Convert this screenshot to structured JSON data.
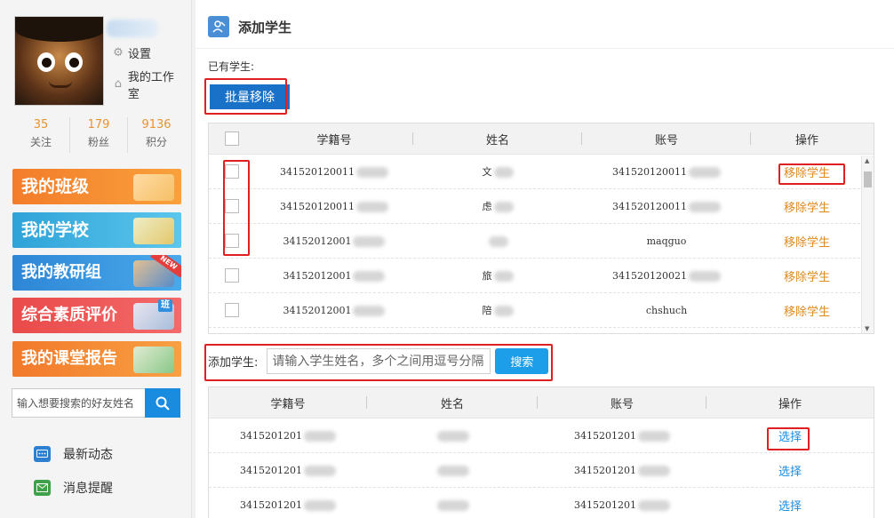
{
  "profile": {
    "settings_label": "设置",
    "studio_label": "我的工作室",
    "stats": [
      {
        "value": "35",
        "label": "关注"
      },
      {
        "value": "179",
        "label": "粉丝"
      },
      {
        "value": "9136",
        "label": "积分"
      }
    ]
  },
  "nav": {
    "my_class": "我的班级",
    "my_school": "我的学校",
    "my_group": "我的教研组",
    "new_badge": "NEW",
    "evaluation": "综合素质评价",
    "class_badge": "班",
    "report": "我的课堂报告"
  },
  "friend_search": {
    "placeholder": "输入想要搜索的好友姓名"
  },
  "menu": {
    "news": "最新动态",
    "messages": "消息提醒"
  },
  "page": {
    "title": "添加学生",
    "existing_label": "已有学生:",
    "bulk_remove": "批量移除"
  },
  "existing_table": {
    "headers": [
      "学籍号",
      "姓名",
      "账号",
      "操作"
    ],
    "rows": [
      {
        "id": "341520120011",
        "name": "文",
        "account": "341520120011",
        "action": "移除学生"
      },
      {
        "id": "341520120011",
        "name": "虑",
        "account": "341520120011",
        "action": "移除学生"
      },
      {
        "id": "34152012001",
        "name": "",
        "account": "maqguo",
        "action": "移除学生"
      },
      {
        "id": "34152012001",
        "name": "旅",
        "account": "341520120021",
        "action": "移除学生"
      },
      {
        "id": "34152012001",
        "name": "陪",
        "account": "chshuch",
        "action": "移除学生"
      }
    ]
  },
  "add_student": {
    "label": "添加学生:",
    "placeholder": "请输入学生姓名，多个之间用逗号分隔",
    "search_button": "搜索"
  },
  "search_table": {
    "headers": [
      "学籍号",
      "姓名",
      "账号",
      "操作"
    ],
    "rows": [
      {
        "id": "3415201201",
        "name": "",
        "account": "3415201201",
        "action": "选择"
      },
      {
        "id": "3415201201",
        "name": "",
        "account": "3415201201",
        "action": "选择"
      },
      {
        "id": "3415201201",
        "name": "",
        "account": "3415201201",
        "action": "选择"
      }
    ]
  },
  "colors": {
    "accent_blue": "#1a71c8",
    "action_orange": "#e08a1e",
    "link_blue": "#1a8ce0",
    "highlight_red": "#e02020"
  }
}
